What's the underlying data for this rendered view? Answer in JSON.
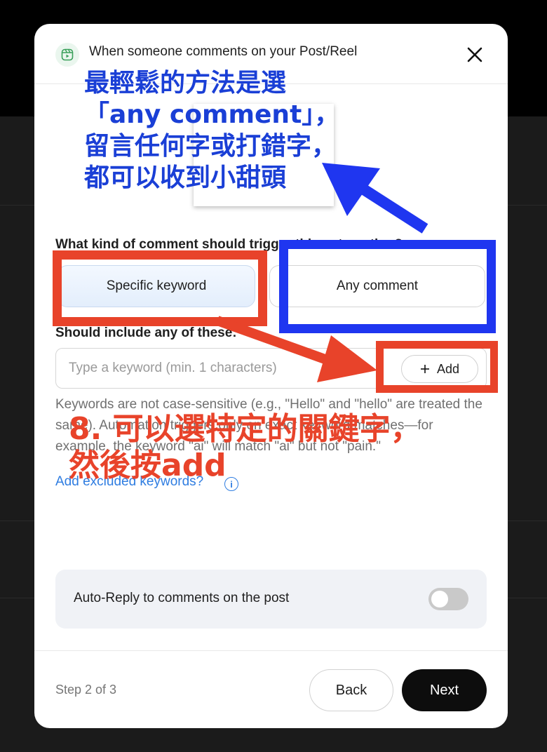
{
  "dialog": {
    "title": "When someone comments on your Post/Reel",
    "icon": "reel-icon"
  },
  "trigger": {
    "question": "What kind of comment should trigger this automation?",
    "options": [
      {
        "label": "Specific keyword",
        "selected": true
      },
      {
        "label": "Any comment",
        "selected": false
      }
    ]
  },
  "keywords": {
    "label": "Should include any of these:",
    "placeholder": "Type a keyword (min. 1 characters)",
    "add_label": "Add",
    "help": "Keywords are not case-sensitive (e.g., \"Hello\" and \"hello\" are treated the same). Automation triggers only on exact keyword matches—for example, the keyword \"ai\" will match \"ai\" but not \"pain.\"",
    "excluded_link": "Add excluded keywords?"
  },
  "auto_reply": {
    "label": "Auto-Reply to comments on the post",
    "enabled": false
  },
  "footer": {
    "step": "Step 2 of 3",
    "back": "Back",
    "next": "Next"
  },
  "annotations": {
    "blue_lines": [
      "最輕鬆的方法是選",
      "「any comment」，",
      "留言任何字或打錯字，",
      "都可以收到小甜頭"
    ],
    "red_lines": [
      "8. 可以選特定的關鍵字，",
      "然後按add"
    ],
    "colors": {
      "red": "#e8432a",
      "blue": "#1f36f0",
      "blue_text": "#1a3fd6"
    }
  }
}
